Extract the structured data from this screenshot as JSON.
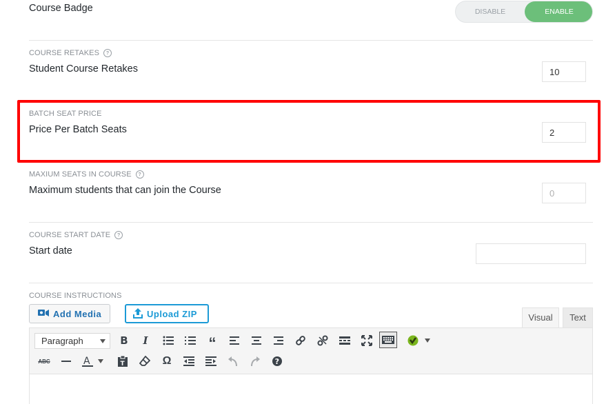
{
  "badge": {
    "title": "Course Badge",
    "toggle_off": "DISABLE",
    "toggle_on": "ENABLE",
    "state": "enabled"
  },
  "retakes": {
    "label": "COURSE RETAKES",
    "title": "Student Course Retakes",
    "value": "10"
  },
  "batch": {
    "label": "BATCH SEAT PRICE",
    "title": "Price Per Batch Seats",
    "value": "2"
  },
  "max_seats": {
    "label": "MAXIUM SEATS IN COURSE",
    "title": "Maximum students that can join the Course",
    "placeholder": "0"
  },
  "start_date": {
    "label": "COURSE START DATE",
    "title": "Start date",
    "value": ""
  },
  "instructions": {
    "label": "COURSE INSTRUCTIONS",
    "add_media": "Add Media",
    "upload_zip": "Upload ZIP",
    "tab_visual": "Visual",
    "tab_text": "Text",
    "format_select": "Paragraph",
    "toolbar_row1": [
      "bold-icon",
      "italic-icon",
      "bullet-list-icon",
      "numbered-list-icon",
      "blockquote-icon",
      "align-left-icon",
      "align-center-icon",
      "align-right-icon",
      "link-icon",
      "unlink-icon",
      "read-more-icon",
      "fullscreen-icon",
      "toolbar-toggle-icon",
      "plugin-check-icon"
    ],
    "toolbar_row2": [
      "strikethrough-icon",
      "horizontal-line-icon",
      "text-color-icon",
      "paste-text-icon",
      "clear-formatting-icon",
      "special-character-icon",
      "outdent-icon",
      "indent-icon",
      "undo-icon",
      "redo-icon",
      "help-icon"
    ]
  },
  "colors": {
    "highlight": "#ff0000",
    "enable": "#6cbf7a",
    "zip_blue": "#1b9ad6",
    "media_blue": "#2271b1"
  }
}
